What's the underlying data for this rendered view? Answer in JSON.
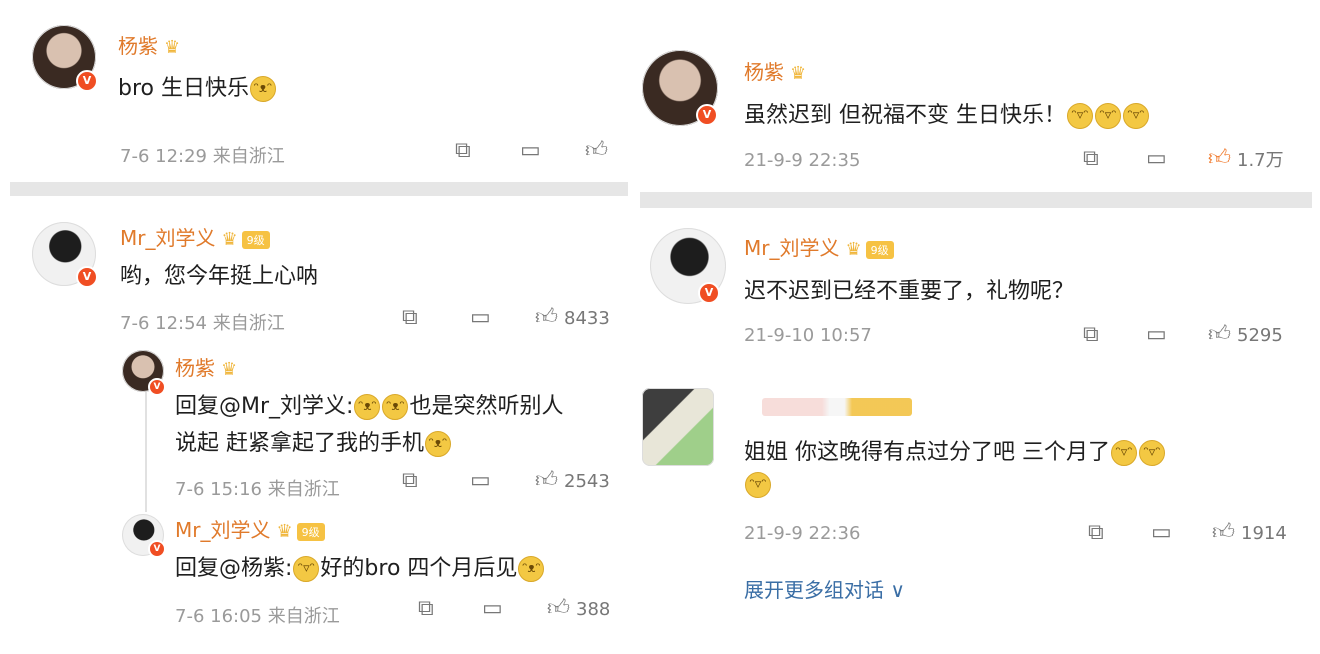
{
  "left": {
    "post": {
      "name": "杨紫",
      "text": "bro 生日快乐",
      "meta": "7-6 12:29 来自浙江",
      "likes": ""
    },
    "comment": {
      "name": "Mr_刘学义",
      "text": "哟，您今年挺上心呐",
      "meta": "7-6 12:54 来自浙江",
      "likes": "8433"
    },
    "reply1": {
      "name": "杨紫",
      "text_line1": "回复@Mr_刘学义:",
      "text_line1b": "也是突然听别人",
      "text_line2": "说起 赶紧拿起了我的手机",
      "meta": "7-6 15:16 来自浙江",
      "likes": "2543"
    },
    "reply2": {
      "name": "Mr_刘学义",
      "text_a": "回复@杨紫:",
      "text_b": "好的bro  四个月后见",
      "meta": "7-6 16:05 来自浙江",
      "likes": "388"
    }
  },
  "right": {
    "post": {
      "name": "杨紫",
      "text": "虽然迟到 但祝福不变 生日快乐！",
      "meta": "21-9-9 22:35",
      "likes": "1.7万"
    },
    "comment": {
      "name": "Mr_刘学义",
      "text": "迟不迟到已经不重要了，礼物呢？",
      "meta": "21-9-10 10:57",
      "likes": "5295"
    },
    "comment2": {
      "text": "姐姐 你这晚得有点过分了吧 三个月了",
      "meta": "21-9-9 22:36",
      "likes": "1914"
    },
    "more": "展开更多组对话 ∨"
  },
  "icons": {
    "share": "share-icon",
    "comment": "comment-icon",
    "like": "thumbs-up-icon",
    "crown": "crown-icon",
    "verified": "verified-icon"
  },
  "colors": {
    "name": "#e07a2b",
    "meta": "#9a9a9a",
    "link": "#3a6ea5",
    "verified": "#f04e23",
    "like_active": "#f07a2d"
  },
  "badges": {
    "vip": "9级"
  }
}
